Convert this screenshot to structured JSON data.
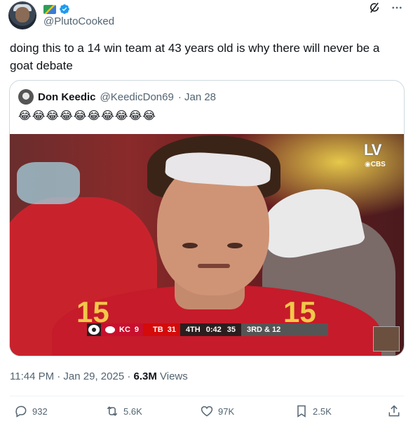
{
  "author": {
    "handle": "@PlutoCooked",
    "avatar_icon": "profile-avatar",
    "badges": [
      "flag-icon",
      "verified-badge-icon"
    ]
  },
  "tweet": {
    "text": "doing this to a 14 win team at 43 years old is why there will never be a goat debate"
  },
  "quoted_tweet": {
    "name": "Don Keedic",
    "handle": "@KeedicDon69",
    "date_meta": "· Jan 28",
    "text": "😂😂😂😂😂😂😂😂😂😂",
    "media": {
      "broadcast_logo": "LV",
      "network": "◉CBS",
      "scorebug": {
        "team1": "KC",
        "score1": "9",
        "team2": "TB",
        "score2": "31",
        "quarter": "4TH",
        "clock": "0:42",
        "play_clock": "35",
        "down_distance": "3RD & 12"
      },
      "jersey_number": "15"
    }
  },
  "timestamp": {
    "time_date": "11:44 PM · Jan 29, 2025 · ",
    "views_count": "6.3M",
    "views_label": " Views"
  },
  "actions": {
    "replies": "932",
    "reposts": "5.6K",
    "likes": "97K",
    "bookmarks": "2.5K"
  },
  "colors": {
    "text": "#0f1419",
    "secondary": "#536471",
    "verified": "#1d9bf0",
    "border": "#cfd9de"
  }
}
